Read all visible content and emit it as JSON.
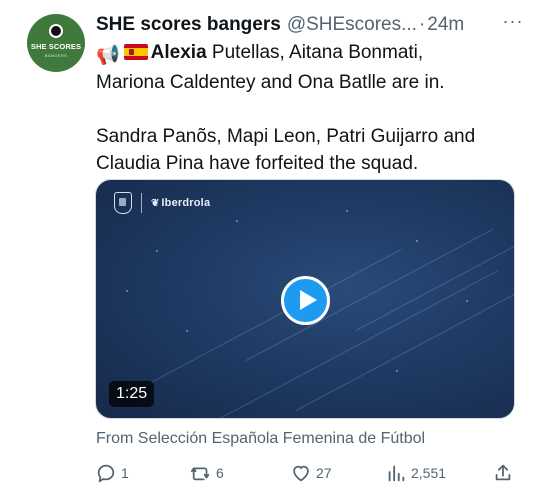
{
  "tweet": {
    "avatar": {
      "logo_text": "SHE SCORES",
      "logo_sub": "BANGERS"
    },
    "display_name": "SHE scores bangers",
    "handle": "@SHEscores...",
    "separator": "·",
    "time": "24m",
    "more_label": "···",
    "text": {
      "line1_emoji": "📢",
      "line1_bold": "Alexia",
      "line1_rest": " Putellas, Aitana Bonmati,",
      "line2": "Mariona Caldentey and Ona Batlle are in.",
      "line3": "Sandra Panõs, Mapi Leon, Patri Guijarro and",
      "line4": "Claudia Pina have forfeited the squad."
    },
    "video": {
      "brand_word": "Iberdrola",
      "duration": "1:25"
    },
    "source": "From Selección Española Femenina de Fútbol",
    "actions": {
      "replies": "1",
      "reposts": "6",
      "likes": "27",
      "views": "2,551"
    }
  },
  "colors": {
    "text": "#0f1419",
    "secondary": "#536471",
    "accent": "#1d9bf0",
    "video_bg": "#1f3b64",
    "avatar_bg": "#3f7a3c"
  }
}
